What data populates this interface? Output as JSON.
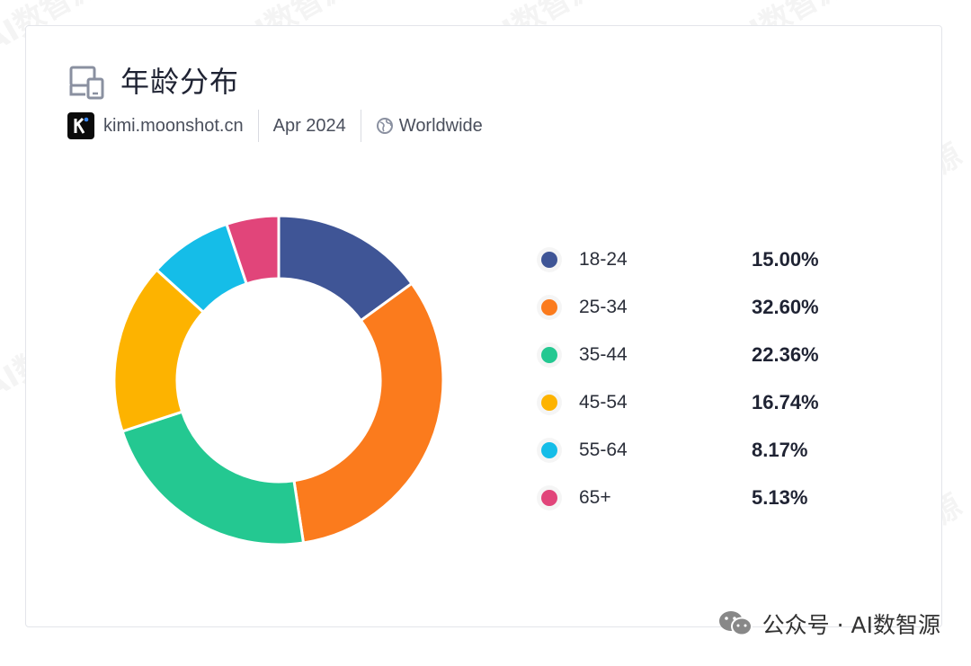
{
  "header": {
    "title": "年龄分布",
    "icon": "devices-icon",
    "site": "kimi.moonshot.cn",
    "period": "Apr 2024",
    "region": "Worldwide"
  },
  "chart_data": {
    "type": "pie",
    "style": "donut",
    "categories": [
      "18-24",
      "25-34",
      "35-44",
      "45-54",
      "55-64",
      "65+"
    ],
    "values": [
      15.0,
      32.6,
      22.36,
      16.74,
      8.17,
      5.13
    ],
    "value_labels": [
      "15.00%",
      "32.60%",
      "22.36%",
      "16.74%",
      "8.17%",
      "5.13%"
    ],
    "colors": [
      "#3f5596",
      "#fb7b1d",
      "#24c891",
      "#fdb300",
      "#15bde8",
      "#e1457a"
    ],
    "legend_position": "right",
    "title": "年龄分布"
  },
  "watermark": "AI数智源",
  "footer": {
    "text": "公众号 · AI数智源",
    "icon": "wechat-icon"
  }
}
